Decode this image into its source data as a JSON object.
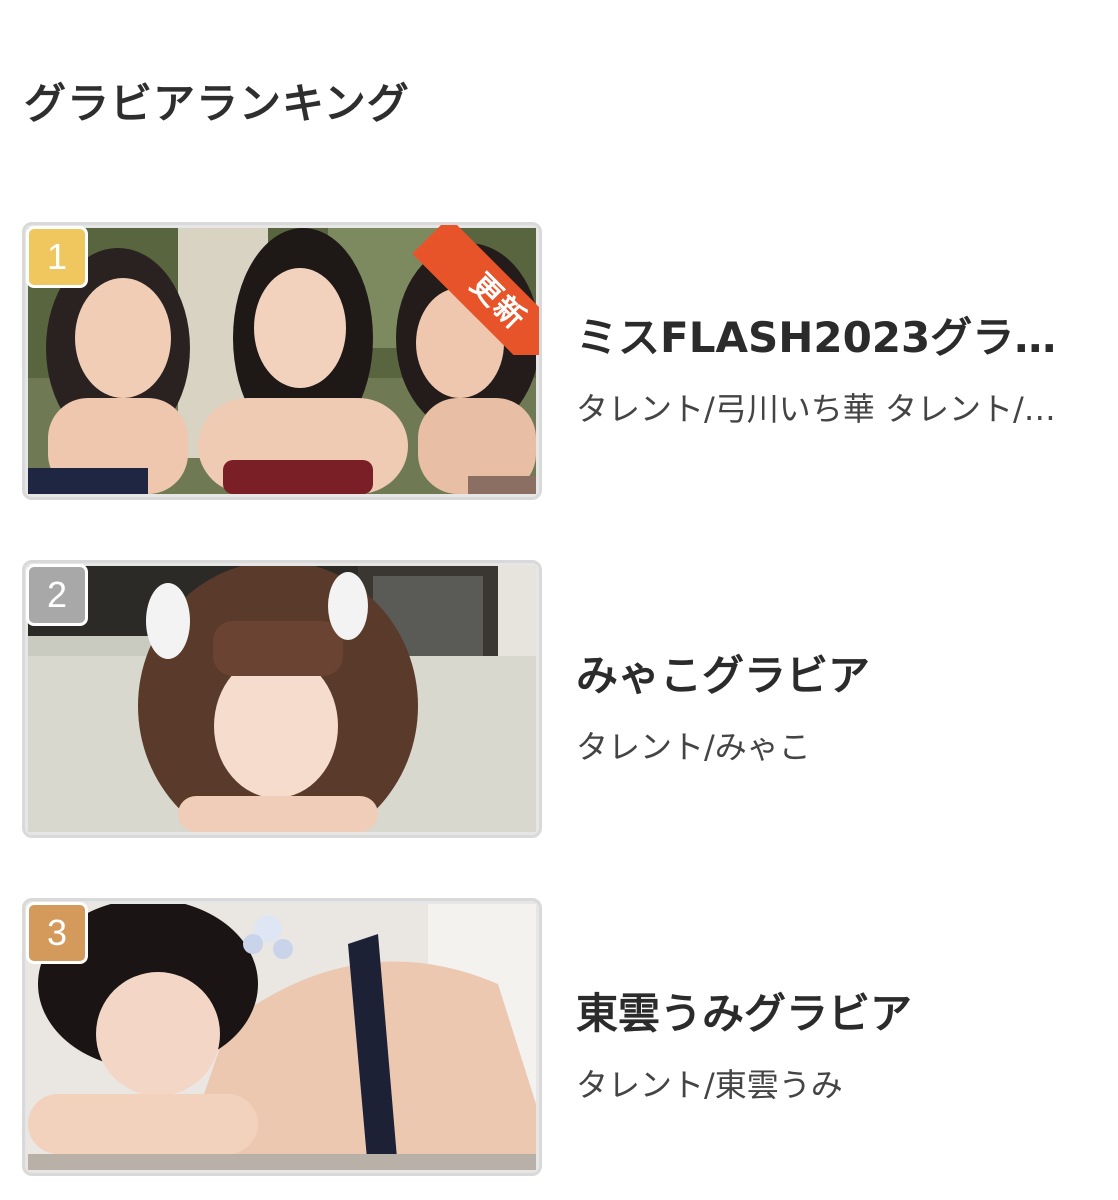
{
  "section": {
    "title": "グラビアランキング"
  },
  "colors": {
    "gold": "#f0c75e",
    "silver": "#a8a8a8",
    "bronze": "#d49a5c",
    "new_ribbon": "#e8542a"
  },
  "items": [
    {
      "rank": "1",
      "badge_color": "gold",
      "new_label": "更新",
      "title": "ミスFLASH2023グラ…",
      "tags": "タレント/弓川いち華 タレント/…"
    },
    {
      "rank": "2",
      "badge_color": "silver",
      "title": "みゃこグラビア",
      "tags": "タレント/みゃこ"
    },
    {
      "rank": "3",
      "badge_color": "bronze",
      "title": "東雲うみグラビア",
      "tags": "タレント/東雲うみ"
    }
  ]
}
